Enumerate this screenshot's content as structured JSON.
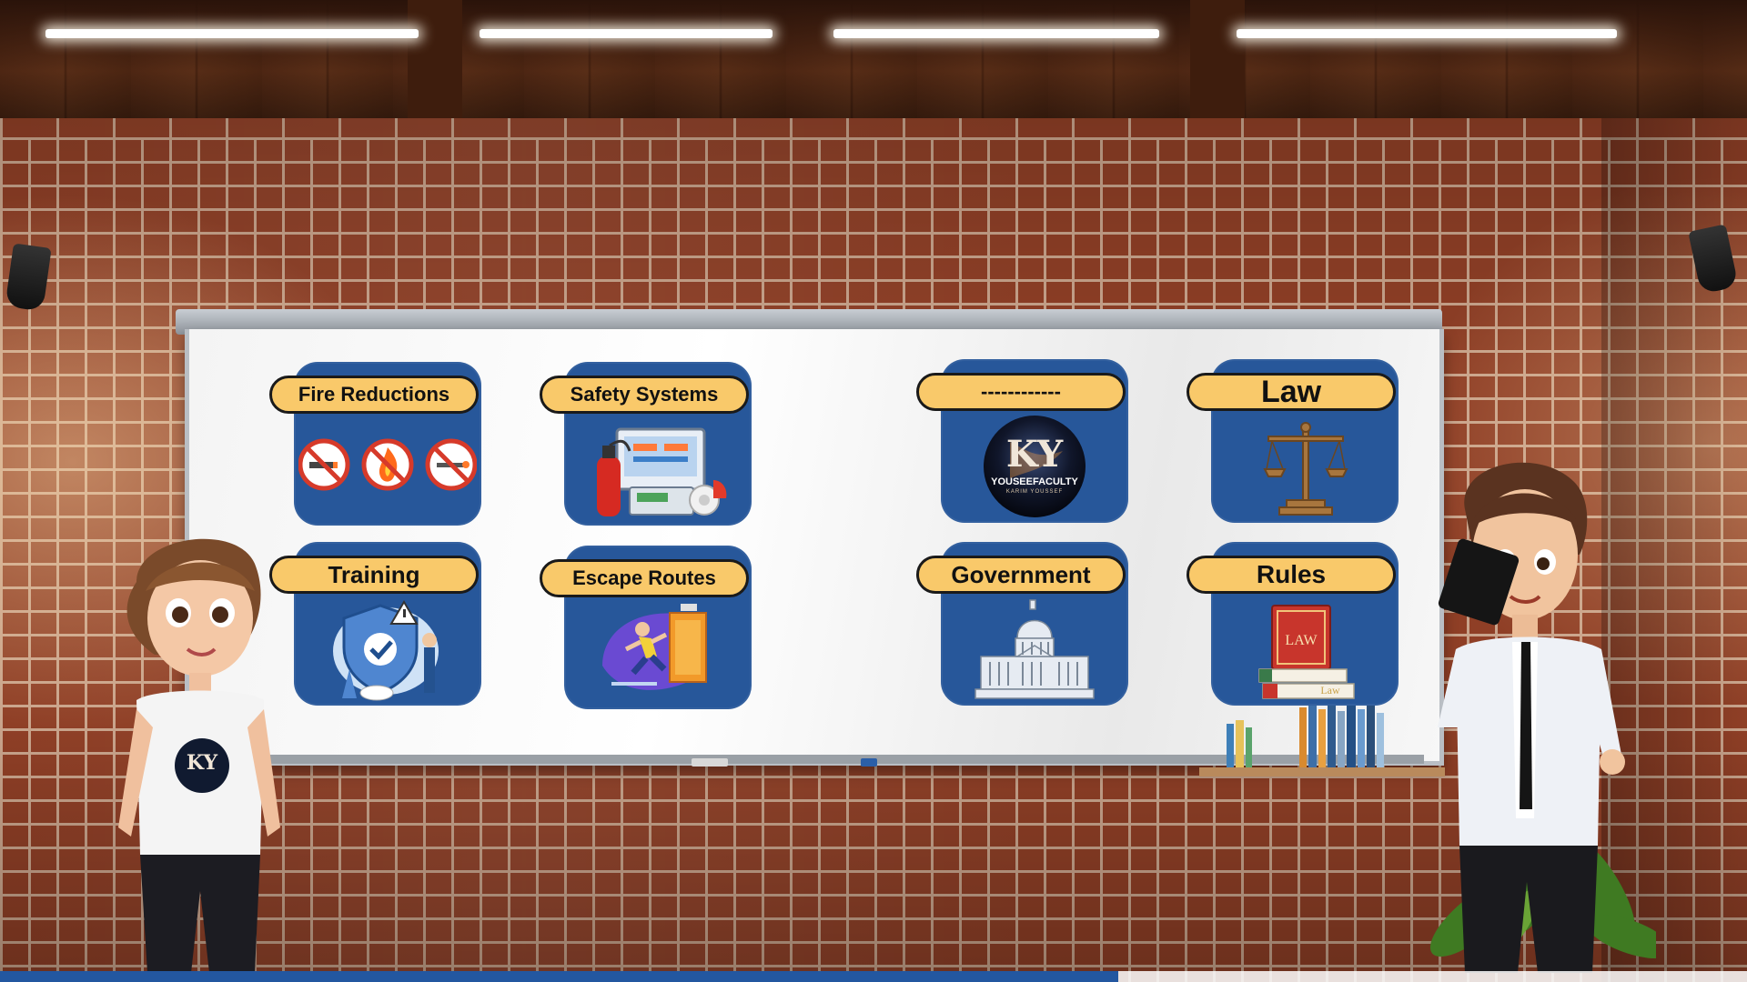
{
  "scene": {
    "colors": {
      "card": "#27579a",
      "tag": "#f9c96a",
      "brick": "#8f3f26",
      "progress": "#2357a0"
    }
  },
  "cards": [
    {
      "label": "Fire Reductions",
      "icon": "no-smoking-no-fire-icons"
    },
    {
      "label": "Safety Systems",
      "icon": "fire-extinguisher-alarm-icon"
    },
    {
      "label": "------------",
      "icon": "yousef-faculty-logo"
    },
    {
      "label": "Law",
      "icon": "scales-of-justice-icon"
    },
    {
      "label": "Training",
      "icon": "shield-check-training-icon"
    },
    {
      "label": "Escape Routes",
      "icon": "running-exit-door-icon"
    },
    {
      "label": "Government",
      "icon": "capitol-building-icon"
    },
    {
      "label": "Rules",
      "icon": "law-book-icon"
    }
  ],
  "logo": {
    "line1": "YOUSEEFACULTY",
    "line2": "KARIM YOUSSEF",
    "monogram": "KY"
  },
  "law_book": {
    "title": "LAW",
    "spine": "Law"
  },
  "presenters": {
    "left": "female-presenter",
    "right": "male-presenter"
  },
  "playback": {
    "progress_fraction": 0.64
  }
}
